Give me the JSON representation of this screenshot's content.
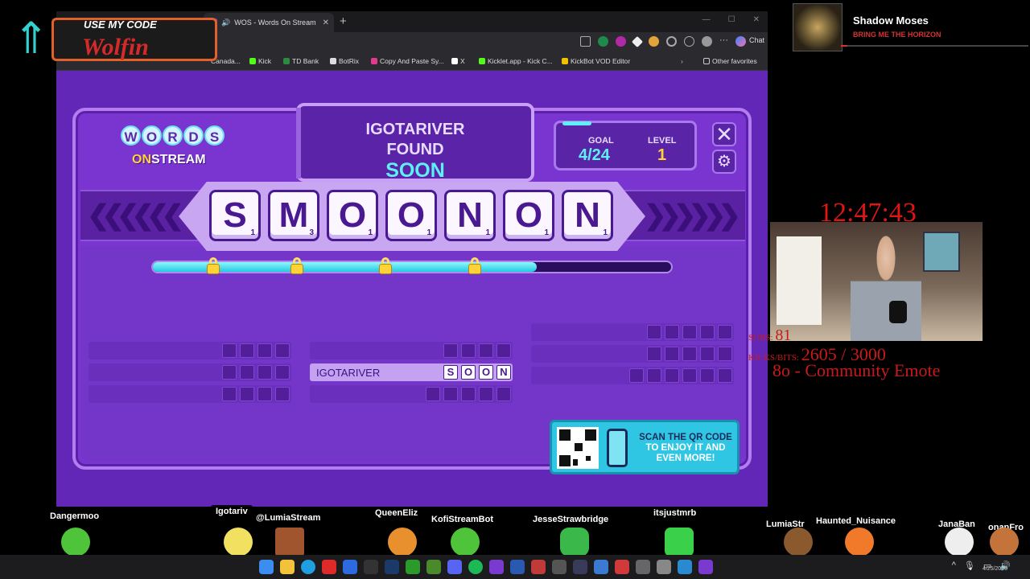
{
  "browser": {
    "tab_title": "WOS - Words On Stream",
    "tab_favicon": "W",
    "chat_label": "Chat",
    "bookmarks": [
      "Canada...",
      "Kick",
      "TD Bank",
      "BotRix",
      "Copy And Paste Sy...",
      "X",
      "Kicklet.app - Kick C...",
      "KickBot VOD Editor"
    ],
    "other_favorites": "Other favorites"
  },
  "game": {
    "logo_words": [
      "W",
      "O",
      "R",
      "D",
      "S"
    ],
    "logo_on": "ON",
    "logo_stream": "STREAM",
    "found_user": "IGOTARIVER",
    "found_label": "FOUND",
    "found_word": "SOON",
    "goal_label": "GOAL",
    "goal_value": "4/24",
    "level_label": "LEVEL",
    "level_value": "1",
    "close_glyph": "✕",
    "gear_glyph": "⚙",
    "tiles": [
      {
        "letter": "S",
        "points": "1"
      },
      {
        "letter": "M",
        "points": "3"
      },
      {
        "letter": "O",
        "points": "1"
      },
      {
        "letter": "O",
        "points": "1"
      },
      {
        "letter": "N",
        "points": "1"
      },
      {
        "letter": "O",
        "points": "1"
      },
      {
        "letter": "N",
        "points": "1"
      }
    ],
    "progress_fraction": 0.74,
    "found_row_user": "IGOTARIVER",
    "found_row_letters": [
      "S",
      "O",
      "O",
      "N"
    ],
    "qr_text_a": "SCAN THE QR CODE",
    "qr_text_b": "TO ENJOY IT AND EVEN MORE!"
  },
  "overlay": {
    "code_label": "USE MY CODE",
    "code_name": "Wolfin",
    "np_title": "Shadow Moses",
    "np_artist": "BRING ME THE HORIZON",
    "clock": "12:47:43",
    "subs_label": "SUBS:",
    "subs_value": "81",
    "kicks_label": "KICKS/BITS:",
    "kicks_value": "2605 / 3000",
    "emote_goal": "8o - Community Emote",
    "chatters": [
      "Dangermoo",
      "Igotariv",
      "@LumiaStream",
      "QueenEliz",
      "KofiStreamBot",
      "JesseStrawbridge",
      "itsjustmrb",
      "LumiaStr",
      "Haunted_Nuisance",
      "JanaBan",
      "onanFro"
    ]
  },
  "taskbar": {
    "date": "4/25/2026"
  },
  "colors": {
    "accent_cyan": "#5ef0f6",
    "game_purple": "#7a35d0",
    "gold": "#ffd23a",
    "overlay_red": "#c81a1a"
  }
}
